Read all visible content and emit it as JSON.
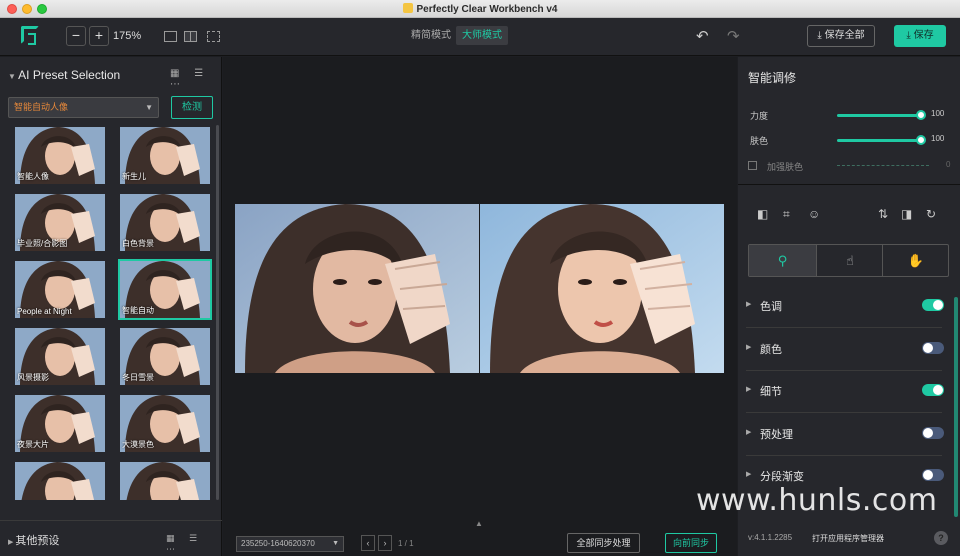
{
  "window": {
    "title": "Perfectly Clear Workbench v4"
  },
  "toolbar": {
    "logo_icon": "perfectly-clear-logo",
    "zoom_minus": "−",
    "zoom_plus": "+",
    "zoom_value": "175%",
    "mode_simple": "精简模式",
    "mode_master": "大师模式",
    "undo": "↶",
    "redo": "↷",
    "save_all": "⤓ 保存全部",
    "save": "⤓ 保存"
  },
  "left_panel": {
    "title": "AI Preset Selection",
    "view_icons": "▦ ☰ ⋯",
    "preset_value": "智能自动人像",
    "detect_button": "检测",
    "thumbnails": [
      {
        "label": "智能人像"
      },
      {
        "label": "新生儿"
      },
      {
        "label": "毕业照/合影图"
      },
      {
        "label": "白色背景"
      },
      {
        "label": "People at Night"
      },
      {
        "label": "智能自动"
      },
      {
        "label": "风景摄影"
      },
      {
        "label": "冬日雪景"
      },
      {
        "label": "夜景大片"
      },
      {
        "label": "大漠景色"
      },
      {
        "label": ""
      },
      {
        "label": ""
      }
    ],
    "other_presets": "其他预设",
    "other_icons": "▦ ☰ ⋯"
  },
  "center": {
    "file_name": "235250-1640620370",
    "nav_prev": "‹",
    "nav_next": "›",
    "page_count": "1 / 1",
    "sync_all": "全部同步处理",
    "sync_forward": "向前同步"
  },
  "right_panel": {
    "title": "智能调修",
    "sliders": [
      {
        "label": "力度",
        "value": "100"
      },
      {
        "label": "肤色",
        "value": "100"
      }
    ],
    "add_skin": {
      "label": "加强肤色",
      "value": "0"
    },
    "tool_icons": [
      "◧",
      "⌗",
      "☺",
      "⇅",
      "◨",
      "↻"
    ],
    "tabs": [
      "⚲",
      "☝",
      "✋"
    ],
    "sections": [
      {
        "label": "色调",
        "on": true
      },
      {
        "label": "颜色",
        "on": false
      },
      {
        "label": "细节",
        "on": true
      },
      {
        "label": "预处理",
        "on": false
      },
      {
        "label": "分段渐变",
        "on": false
      }
    ],
    "version": "v:4.1.1.2285",
    "open_manager": "打开应用程序管理器",
    "help": "?"
  },
  "watermark": "www.hunls.com",
  "colors": {
    "accent": "#1fc9a3",
    "panel": "#26272c",
    "canvas": "#1b1c1f"
  }
}
